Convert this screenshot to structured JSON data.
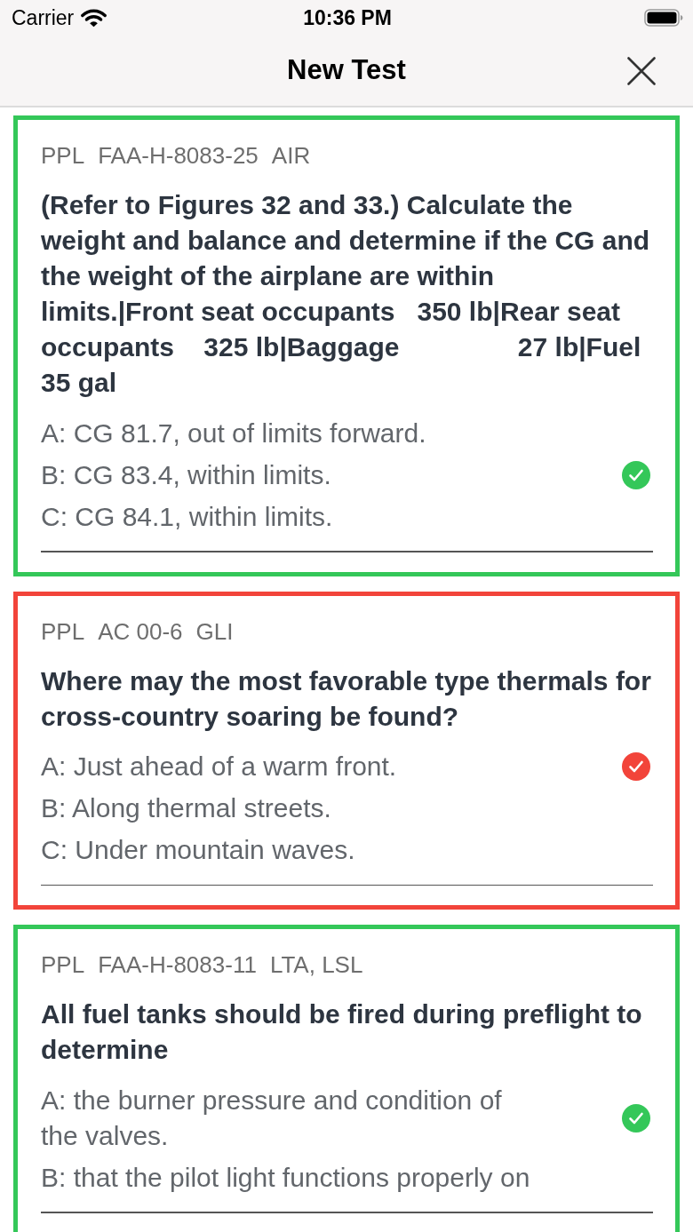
{
  "status_bar": {
    "carrier": "Carrier",
    "time": "10:36 PM"
  },
  "nav_bar": {
    "title": "New Test"
  },
  "questions": [
    {
      "correct": true,
      "tags": [
        "PPL",
        "FAA-H-8083-25",
        "AIR"
      ],
      "text": "(Refer to Figures 32 and 33.) Calculate the weight and balance and determine if the CG and the weight of the airplane are within limits.|Front seat occupants   350 lb|Rear seat occupants    325 lb|Baggage                27 lb|Fuel                  35 gal",
      "answers": [
        {
          "text": "A: CG 81.7, out of limits forward.",
          "selected": false
        },
        {
          "text": "B: CG 83.4, within limits.",
          "selected": true
        },
        {
          "text": "C: CG 84.1, within limits.",
          "selected": false
        }
      ]
    },
    {
      "correct": false,
      "tags": [
        "PPL",
        "AC 00-6",
        "GLI"
      ],
      "text": "Where may the most favorable type thermals for cross-country soaring be found?",
      "answers": [
        {
          "text": "A: Just ahead of a warm front.",
          "selected": true
        },
        {
          "text": "B: Along thermal streets.",
          "selected": false
        },
        {
          "text": "C: Under mountain waves.",
          "selected": false
        }
      ]
    },
    {
      "correct": true,
      "tags": [
        "PPL",
        "FAA-H-8083-11",
        "LTA, LSL"
      ],
      "text": "All fuel tanks should be fired during preflight to determine",
      "answers": [
        {
          "text": "A: the burner pressure and condition of the valves.",
          "selected": true
        },
        {
          "text": "B: that the pilot light functions properly on",
          "selected": false
        }
      ]
    }
  ]
}
